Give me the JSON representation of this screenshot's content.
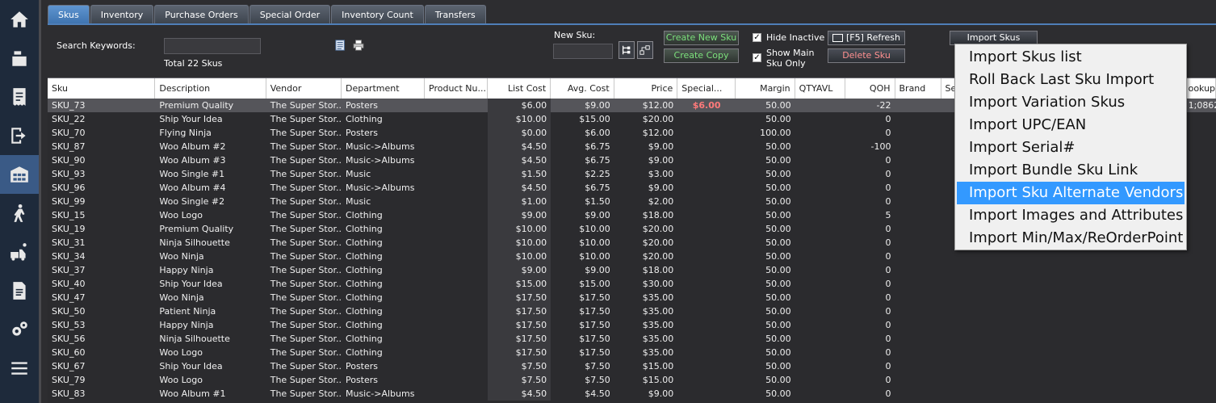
{
  "nav": {
    "items": [
      {
        "icon": "home-icon"
      },
      {
        "icon": "cash-register-icon"
      },
      {
        "icon": "receipt-icon"
      },
      {
        "icon": "sign-out-icon"
      },
      {
        "icon": "warehouse-icon",
        "active": true
      },
      {
        "icon": "person-walking-icon"
      },
      {
        "icon": "delivery-icon"
      },
      {
        "icon": "report-icon"
      },
      {
        "icon": "settings-icon"
      },
      {
        "icon": "menu-icon"
      }
    ]
  },
  "tabs": [
    "Skus",
    "Inventory",
    "Purchase Orders",
    "Special Order",
    "Inventory Count",
    "Transfers"
  ],
  "toolbar": {
    "search_label": "Search Keywords:",
    "total_label": "Total 22 Skus",
    "new_sku_label": "New Sku:",
    "create_new_sku": "Create New Sku",
    "create_copy": "Create Copy",
    "hide_inactive": "Hide Inactive",
    "show_main_1": "Show Main",
    "show_main_2": "Sku Only",
    "refresh": "[F5] Refresh",
    "delete_sku": "Delete Sku",
    "import_skus": "Import Skus"
  },
  "columns": [
    "Sku",
    "Description",
    "Vendor",
    "Department",
    "Product Nu...",
    "List Cost",
    "Avg. Cost",
    "Price",
    "Special...",
    "Margin",
    "QTYAVL",
    "QOH",
    "Brand",
    "Seas",
    "",
    "ookups"
  ],
  "rows": [
    [
      "SKU_73",
      "Premium Quality",
      "The Super Stor...",
      "Posters",
      "",
      "$6.00",
      "$9.00",
      "$12.00",
      "$6.00",
      "50.00",
      "",
      "-22",
      "",
      "",
      "",
      "1;0862"
    ],
    [
      "SKU_22",
      "Ship Your Idea",
      "The Super Stor...",
      "Clothing",
      "",
      "$10.00",
      "$15.00",
      "$20.00",
      "",
      "50.00",
      "",
      "0",
      "",
      "",
      "",
      ""
    ],
    [
      "SKU_70",
      "Flying Ninja",
      "The Super Stor...",
      "Posters",
      "",
      "$0.00",
      "$6.00",
      "$12.00",
      "",
      "100.00",
      "",
      "0",
      "",
      "",
      "",
      ""
    ],
    [
      "SKU_87",
      "Woo Album #2",
      "The Super Stor...",
      "Music->Albums",
      "",
      "$4.50",
      "$6.75",
      "$9.00",
      "",
      "50.00",
      "",
      "-100",
      "",
      "",
      "",
      ""
    ],
    [
      "SKU_90",
      "Woo Album #3",
      "The Super Stor...",
      "Music->Albums",
      "",
      "$4.50",
      "$6.75",
      "$9.00",
      "",
      "50.00",
      "",
      "0",
      "",
      "",
      "",
      ""
    ],
    [
      "SKU_93",
      "Woo Single #1",
      "The Super Stor...",
      "Music",
      "",
      "$1.50",
      "$2.25",
      "$3.00",
      "",
      "50.00",
      "",
      "0",
      "",
      "",
      "",
      ""
    ],
    [
      "SKU_96",
      "Woo Album #4",
      "The Super Stor...",
      "Music->Albums",
      "",
      "$4.50",
      "$6.75",
      "$9.00",
      "",
      "50.00",
      "",
      "0",
      "",
      "",
      "",
      ""
    ],
    [
      "SKU_99",
      "Woo Single #2",
      "The Super Stor...",
      "Music",
      "",
      "$1.00",
      "$1.50",
      "$2.00",
      "",
      "50.00",
      "",
      "0",
      "",
      "",
      "",
      ""
    ],
    [
      "SKU_15",
      "Woo Logo",
      "The Super Stor...",
      "Clothing",
      "",
      "$9.00",
      "$9.00",
      "$18.00",
      "",
      "50.00",
      "",
      "5",
      "",
      "",
      "",
      ""
    ],
    [
      "SKU_19",
      "Premium Quality",
      "The Super Stor...",
      "Clothing",
      "",
      "$10.00",
      "$10.00",
      "$20.00",
      "",
      "50.00",
      "",
      "0",
      "",
      "",
      "",
      ""
    ],
    [
      "SKU_31",
      "Ninja Silhouette",
      "The Super Stor...",
      "Clothing",
      "",
      "$10.00",
      "$10.00",
      "$20.00",
      "",
      "50.00",
      "",
      "0",
      "",
      "",
      "",
      ""
    ],
    [
      "SKU_34",
      "Woo Ninja",
      "The Super Stor...",
      "Clothing",
      "",
      "$10.00",
      "$10.00",
      "$20.00",
      "",
      "50.00",
      "",
      "0",
      "",
      "",
      "",
      ""
    ],
    [
      "SKU_37",
      "Happy Ninja",
      "The Super Stor...",
      "Clothing",
      "",
      "$9.00",
      "$9.00",
      "$18.00",
      "",
      "50.00",
      "",
      "0",
      "",
      "",
      "",
      ""
    ],
    [
      "SKU_40",
      "Ship Your Idea",
      "The Super Stor...",
      "Clothing",
      "",
      "$15.00",
      "$15.00",
      "$30.00",
      "",
      "50.00",
      "",
      "0",
      "",
      "",
      "",
      ""
    ],
    [
      "SKU_47",
      "Woo Ninja",
      "The Super Stor...",
      "Clothing",
      "",
      "$17.50",
      "$17.50",
      "$35.00",
      "",
      "50.00",
      "",
      "0",
      "",
      "",
      "",
      ""
    ],
    [
      "SKU_50",
      "Patient Ninja",
      "The Super Stor...",
      "Clothing",
      "",
      "$17.50",
      "$17.50",
      "$35.00",
      "",
      "50.00",
      "",
      "0",
      "",
      "",
      "",
      ""
    ],
    [
      "SKU_53",
      "Happy Ninja",
      "The Super Stor...",
      "Clothing",
      "",
      "$17.50",
      "$17.50",
      "$35.00",
      "",
      "50.00",
      "",
      "0",
      "",
      "",
      "",
      ""
    ],
    [
      "SKU_56",
      "Ninja Silhouette",
      "The Super Stor...",
      "Clothing",
      "",
      "$17.50",
      "$17.50",
      "$35.00",
      "",
      "50.00",
      "",
      "0",
      "",
      "",
      "",
      ""
    ],
    [
      "SKU_60",
      "Woo Logo",
      "The Super Stor...",
      "Clothing",
      "",
      "$17.50",
      "$17.50",
      "$35.00",
      "",
      "50.00",
      "",
      "0",
      "",
      "",
      "",
      ""
    ],
    [
      "SKU_67",
      "Ship Your Idea",
      "The Super Stor...",
      "Posters",
      "",
      "$7.50",
      "$7.50",
      "$15.00",
      "",
      "50.00",
      "",
      "0",
      "",
      "",
      "",
      ""
    ],
    [
      "SKU_79",
      "Woo Logo",
      "The Super Stor...",
      "Posters",
      "",
      "$7.50",
      "$7.50",
      "$15.00",
      "",
      "50.00",
      "",
      "0",
      "",
      "",
      "",
      ""
    ],
    [
      "SKU_83",
      "Woo Album #1",
      "The Super Stor...",
      "Music->Albums",
      "",
      "$4.50",
      "$4.50",
      "$9.00",
      "",
      "50.00",
      "",
      "0",
      "",
      "",
      "",
      ""
    ]
  ],
  "import_menu": [
    "Import Skus list",
    "Roll Back Last Sku Import",
    "Import Variation Skus",
    "Import UPC/EAN",
    "Import Serial#",
    "Import Bundle Sku Link",
    "Import Sku Alternate Vendors",
    "Import Images and Attributes",
    "Import Min/Max/ReOrderPoint"
  ],
  "import_menu_highlighted": "Import Sku Alternate Vendors"
}
